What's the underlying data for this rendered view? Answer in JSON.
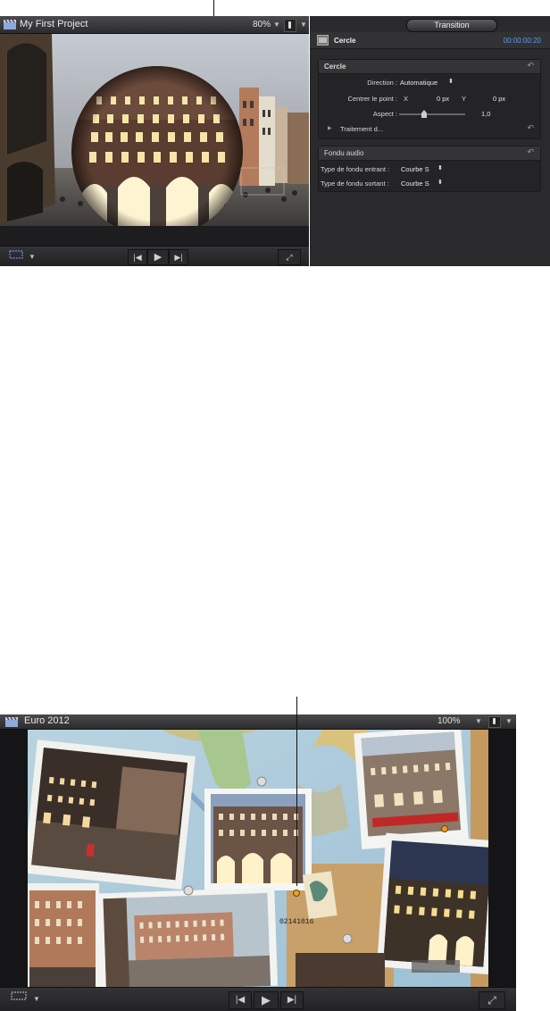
{
  "top_viewer": {
    "title": "My First Project",
    "zoom": "80%"
  },
  "inspector": {
    "tab": "Transition",
    "effect_name": "Cercle",
    "timecode": "00:00:00:20",
    "sections": {
      "cercle": {
        "title": "Cercle",
        "direction_label": "Direction :",
        "direction_value": "Automatique",
        "center_label": "Centrer le point :",
        "x_label": "X",
        "x_value": "0 px",
        "y_label": "Y",
        "y_value": "0 px",
        "aspect_label": "Aspect :",
        "aspect_value": "1,0",
        "treatment_label": "Traitement d..."
      },
      "fondu": {
        "title": "Fondu audio",
        "in_label": "Type de fondu entrant :",
        "in_value": "Courbe S",
        "out_label": "Type de fondu sortant :",
        "out_value": "Courbe S"
      }
    }
  },
  "bottom_viewer": {
    "title": "Euro 2012",
    "zoom": "100%",
    "stamp_text": "02141016"
  },
  "icons": [
    "clapper-icon",
    "chevron-down-icon",
    "audio-meter-icon",
    "reset-icon",
    "disclosure-triangle-icon",
    "go-to-start-icon",
    "play-icon",
    "go-to-end-icon",
    "fullscreen-icon",
    "view-options-icon",
    "stepper-icon",
    "transition-icon"
  ]
}
